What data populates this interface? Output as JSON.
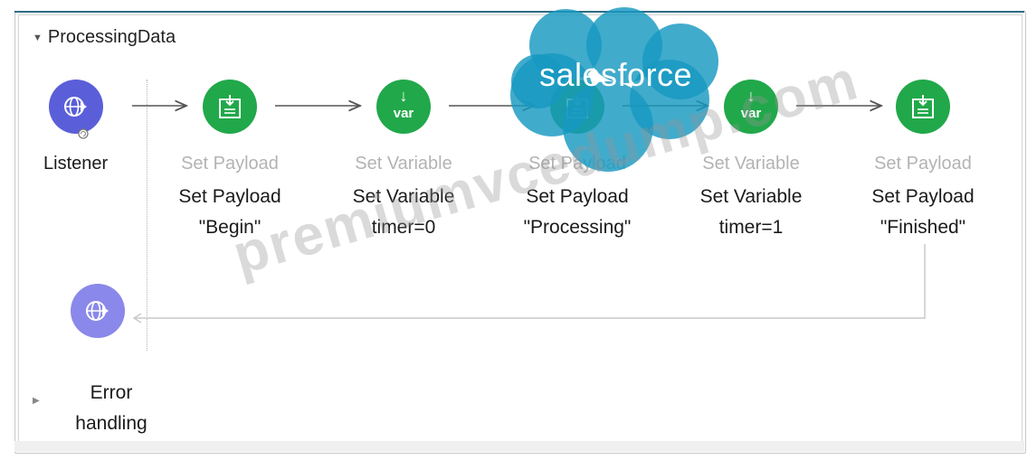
{
  "flow": {
    "title": "ProcessingData",
    "source": {
      "label": "Listener"
    },
    "steps": [
      {
        "type_label": "Set Payload",
        "line1": "Set Payload",
        "line2": "\"Begin\"",
        "icon": "set-payload-icon"
      },
      {
        "type_label": "Set Variable",
        "line1": "Set Variable",
        "line2": "timer=0",
        "icon": "var-icon"
      },
      {
        "type_label": "Set Payload",
        "line1": "Set Payload",
        "line2": "\"Processing\"",
        "icon": "set-payload-icon"
      },
      {
        "type_label": "Set Variable",
        "line1": "Set Variable",
        "line2": "timer=1",
        "icon": "var-icon"
      },
      {
        "type_label": "Set Payload",
        "line1": "Set Payload",
        "line2": "\"Finished\"",
        "icon": "set-payload-icon"
      }
    ],
    "error_handling": {
      "line1": "Error",
      "line2": "handling"
    },
    "var_text": "var"
  },
  "overlays": {
    "salesforce_logo_text": "salesforce",
    "watermark_text": "premiumvcedump.com"
  },
  "colors": {
    "step_green": "#21a84a",
    "listener_purple": "#5a5fd9",
    "error_lavender": "#8a88ea",
    "cloud_blue": "#1798c1",
    "accent_bar": "#2d6d84"
  }
}
